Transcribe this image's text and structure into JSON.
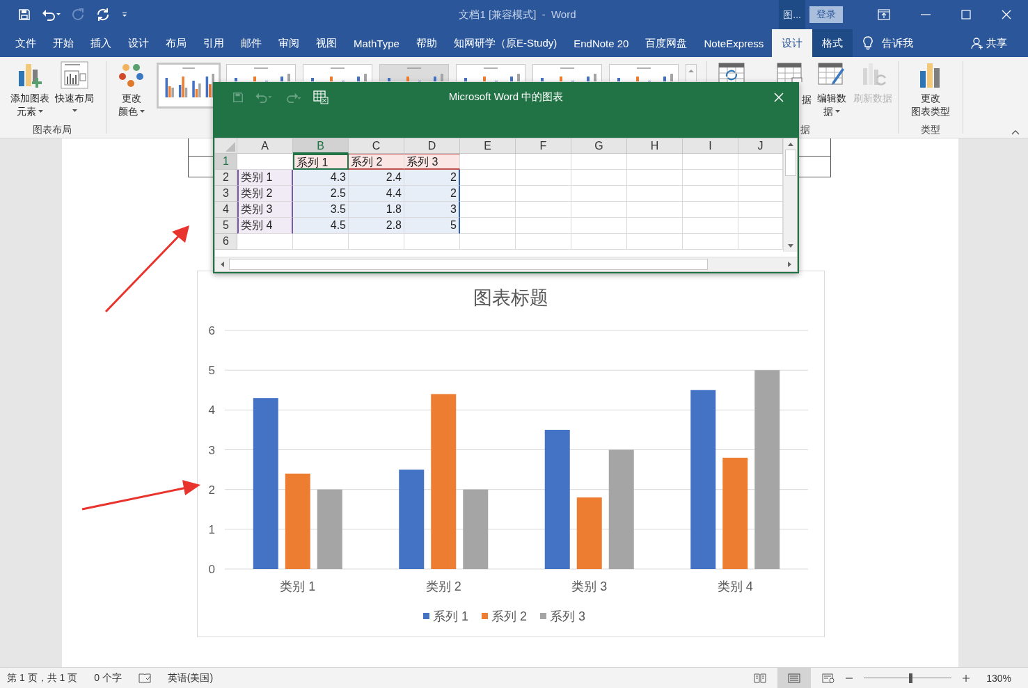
{
  "title_bar": {
    "title": "文档1 [兼容模式]  -  Word",
    "context_label": "图...",
    "sign_in": "登录"
  },
  "tabs": [
    {
      "label": "文件",
      "kind": "normal",
      "selected": false
    },
    {
      "label": "开始",
      "kind": "normal",
      "selected": false
    },
    {
      "label": "插入",
      "kind": "normal",
      "selected": false
    },
    {
      "label": "设计",
      "kind": "normal",
      "selected": false
    },
    {
      "label": "布局",
      "kind": "normal",
      "selected": false
    },
    {
      "label": "引用",
      "kind": "normal",
      "selected": false
    },
    {
      "label": "邮件",
      "kind": "normal",
      "selected": false
    },
    {
      "label": "审阅",
      "kind": "normal",
      "selected": false
    },
    {
      "label": "视图",
      "kind": "normal",
      "selected": false
    },
    {
      "label": "MathType",
      "kind": "normal",
      "selected": false
    },
    {
      "label": "帮助",
      "kind": "normal",
      "selected": false
    },
    {
      "label": "知网研学（原E-Study)",
      "kind": "normal",
      "selected": false
    },
    {
      "label": "EndNote 20",
      "kind": "normal",
      "selected": false
    },
    {
      "label": "百度网盘",
      "kind": "normal",
      "selected": false
    },
    {
      "label": "NoteExpress",
      "kind": "normal",
      "selected": false
    },
    {
      "label": "设计",
      "kind": "contextual",
      "selected": true
    },
    {
      "label": "格式",
      "kind": "contextual",
      "selected": false
    }
  ],
  "tell_me": "告诉我",
  "share": "共享",
  "ribbon": {
    "layout_group": {
      "label": "图表布局",
      "buttons": [
        {
          "lines": [
            "添加图表",
            "元素"
          ],
          "dropdown": true
        },
        {
          "lines": [
            "快速布局"
          ],
          "dropdown": true
        }
      ]
    },
    "colors_button": {
      "lines": [
        "更改",
        "颜色"
      ],
      "dropdown": true
    },
    "data_group": {
      "label": "据",
      "buttons": [
        {
          "lines": [
            "据"
          ],
          "disabled": false
        },
        {
          "lines": [
            "编辑数",
            "据"
          ],
          "disabled": false
        },
        {
          "lines": [
            "刷新数据"
          ],
          "disabled": true
        }
      ]
    },
    "type_group": {
      "label": "类型",
      "button": {
        "lines": [
          "更改",
          "图表类型"
        ]
      }
    }
  },
  "sheet_window": {
    "title": "Microsoft Word 中的图表",
    "columns": [
      {
        "label": "A",
        "selected": false
      },
      {
        "label": "B",
        "selected": true
      },
      {
        "label": "C",
        "selected": false
      },
      {
        "label": "D",
        "selected": false
      },
      {
        "label": "E",
        "selected": false
      },
      {
        "label": "F",
        "selected": false
      },
      {
        "label": "G",
        "selected": false
      },
      {
        "label": "H",
        "selected": false
      },
      {
        "label": "I",
        "selected": false
      },
      {
        "label": "J",
        "selected": false
      }
    ],
    "rows": [
      {
        "row": "1",
        "kind": "header",
        "selected": true,
        "B": "系列 1",
        "C": "系列 2",
        "D": "系列 3"
      },
      {
        "row": "2",
        "kind": "data",
        "selected": false,
        "A": "类别 1",
        "B": "4.3",
        "C": "2.4",
        "D": "2"
      },
      {
        "row": "3",
        "kind": "data",
        "selected": false,
        "A": "类别 2",
        "B": "2.5",
        "C": "4.4",
        "D": "2"
      },
      {
        "row": "4",
        "kind": "data",
        "selected": false,
        "A": "类别 3",
        "B": "3.5",
        "C": "1.8",
        "D": "3"
      },
      {
        "row": "5",
        "kind": "data",
        "selected": false,
        "A": "类别 4",
        "B": "4.5",
        "C": "2.8",
        "D": "5"
      },
      {
        "row": "6",
        "selected": false
      }
    ]
  },
  "chart_data": {
    "type": "bar",
    "title": "图表标题",
    "categories": [
      "类别 1",
      "类别 2",
      "类别 3",
      "类别 4"
    ],
    "series": [
      {
        "name": "系列 1",
        "color": "#4472c4",
        "values": [
          4.3,
          2.5,
          3.5,
          4.5
        ]
      },
      {
        "name": "系列 2",
        "color": "#ed7d31",
        "values": [
          2.4,
          4.4,
          1.8,
          2.8
        ]
      },
      {
        "name": "系列 3",
        "color": "#a5a5a5",
        "values": [
          2,
          2,
          3,
          5
        ]
      }
    ],
    "ylim": [
      0,
      6
    ],
    "yticks": [
      0,
      1,
      2,
      3,
      4,
      5,
      6
    ],
    "grid": true,
    "legend": true
  },
  "status_bar": {
    "page": "第 1 页，共 1 页",
    "words": "0 个字",
    "language": "英语(美国)",
    "zoom": "130%",
    "zoom_slider": {
      "level": 0.53
    }
  }
}
